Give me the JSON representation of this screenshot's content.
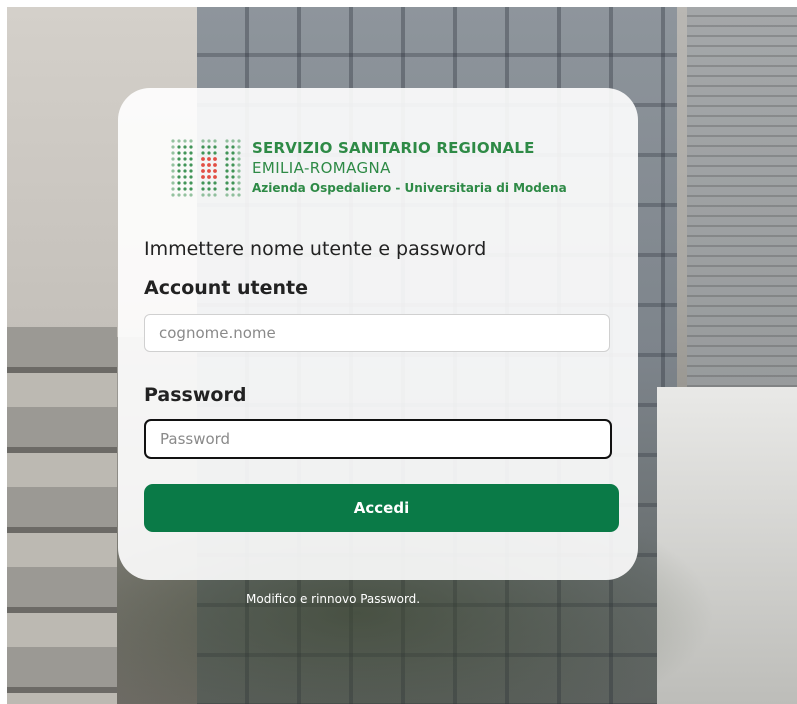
{
  "branding": {
    "line1": "SERVIZIO SANITARIO REGIONALE",
    "line2": "EMILIA-ROMAGNA",
    "line3": "Azienda Ospedaliero - Universitaria di Modena",
    "color": "#2e8a46",
    "accent": "#e03c31",
    "icon": "ssr-logo-icon"
  },
  "form": {
    "title": "Immettere nome utente e password",
    "username_label": "Account utente",
    "username_placeholder": "cognome.nome",
    "password_label": "Password",
    "password_placeholder": "Password",
    "submit_label": "Accedi",
    "submit_color": "#0a7a47"
  },
  "footer": {
    "link_label": "Modifico e rinnovo Password."
  }
}
